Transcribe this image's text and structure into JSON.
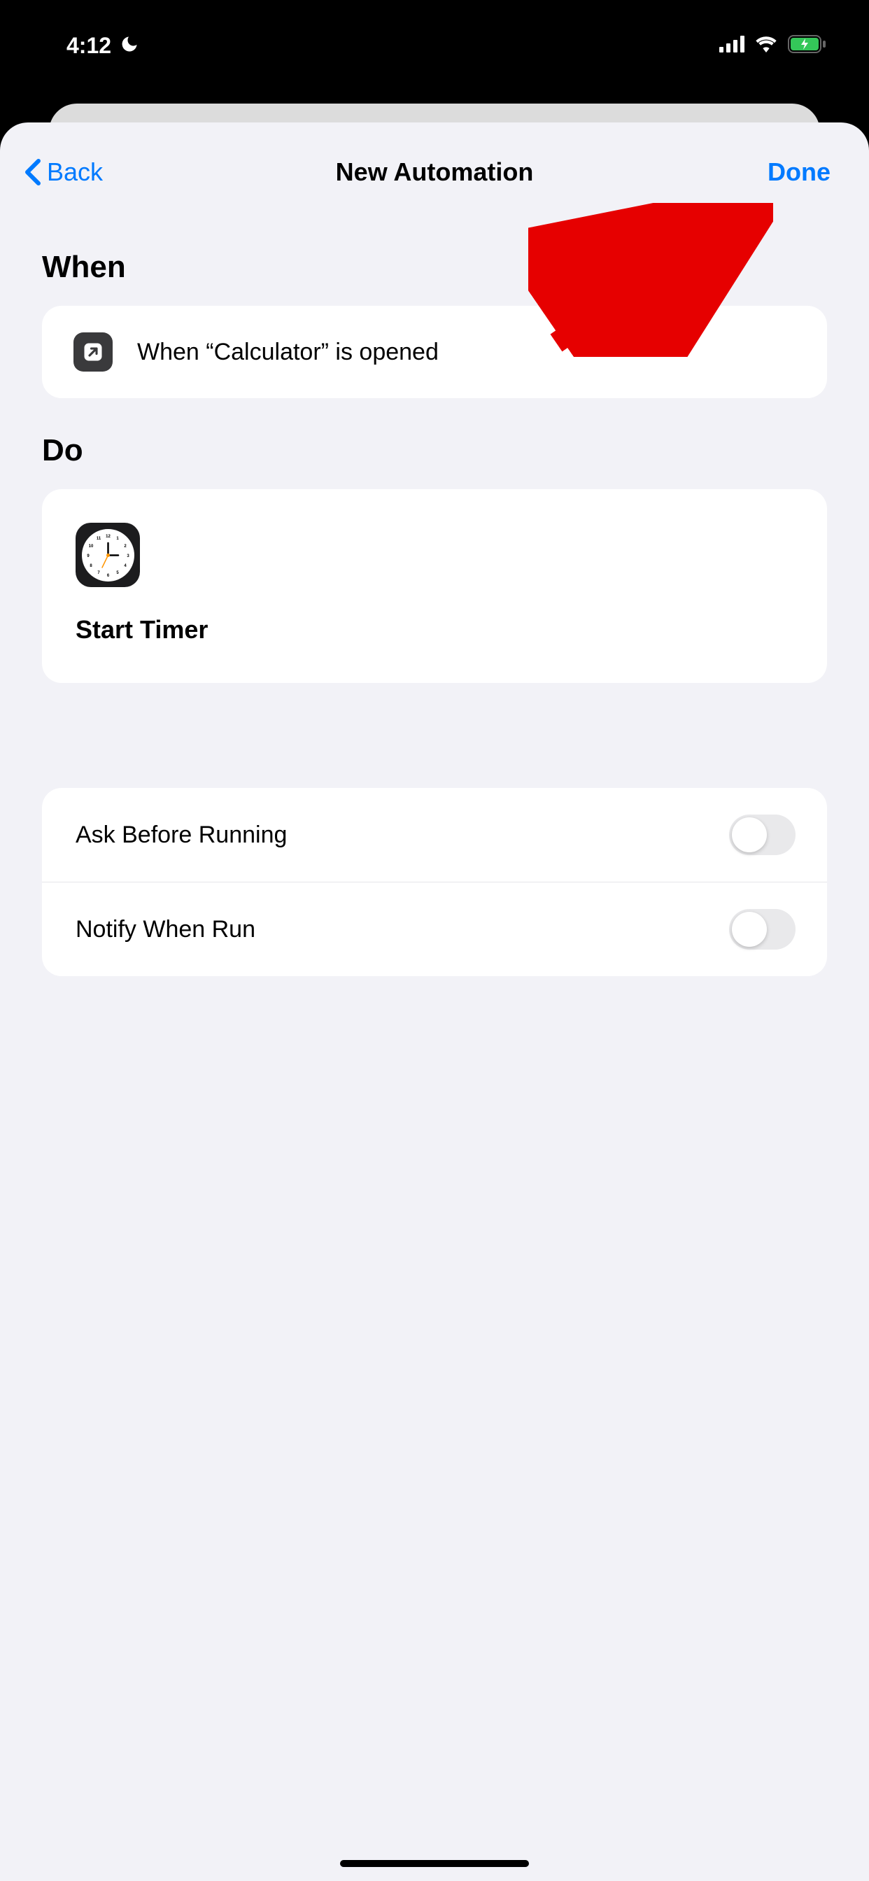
{
  "status": {
    "time": "4:12"
  },
  "nav": {
    "back_label": "Back",
    "title": "New Automation",
    "done_label": "Done"
  },
  "sections": {
    "when_header": "When",
    "do_header": "Do"
  },
  "when": {
    "trigger_text": "When “Calculator” is opened"
  },
  "do": {
    "action_title": "Start Timer"
  },
  "settings": {
    "ask_before_running": {
      "label": "Ask Before Running",
      "enabled": false
    },
    "notify_when_run": {
      "label": "Notify When Run",
      "enabled": false
    }
  }
}
